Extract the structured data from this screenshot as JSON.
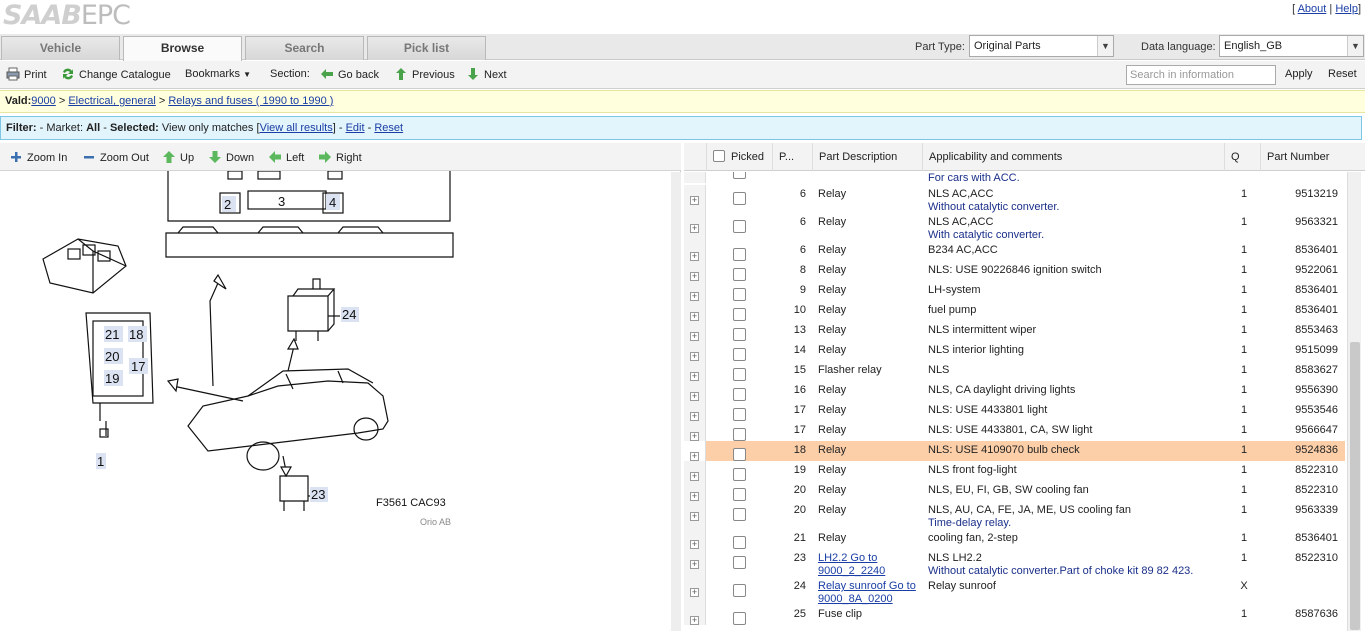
{
  "app": {
    "logo_brand": "SAAB",
    "logo_product": "EPC"
  },
  "toplinks": {
    "about": "About",
    "help": "Help"
  },
  "tabs": [
    {
      "label": "Vehicle"
    },
    {
      "label": "Browse"
    },
    {
      "label": "Search"
    },
    {
      "label": "Pick list"
    }
  ],
  "part_type": {
    "label": "Part Type:",
    "value": "Original Parts"
  },
  "data_language": {
    "label": "Data language:",
    "value": "English_GB"
  },
  "toolbar": {
    "print": "Print",
    "change_catalogue": "Change Catalogue",
    "bookmarks": "Bookmarks",
    "section": "Section:",
    "go_back": "Go back",
    "previous": "Previous",
    "next": "Next",
    "search_placeholder": "Search in information",
    "apply": "Apply",
    "reset": "Reset"
  },
  "breadcrumb": {
    "prefix": "Vald:",
    "model": "9000",
    "group": "Electrical, general",
    "section": "Relays and fuses ( 1990 to 1990 )"
  },
  "filter": {
    "label": "Filter:",
    "market_label": "Market:",
    "market": "All",
    "selected_label": "Selected:",
    "selected": "View only matches",
    "view_all": "View all results",
    "edit": "Edit",
    "reset": "Reset"
  },
  "zoombar": {
    "zoom_in": "Zoom In",
    "zoom_out": "Zoom Out",
    "up": "Up",
    "down": "Down",
    "left": "Left",
    "right": "Right"
  },
  "illustration": {
    "code": "F3561 CAC93",
    "copyright": "Orio AB",
    "callouts": [
      "2",
      "3",
      "4",
      "21",
      "18",
      "20",
      "17",
      "19",
      "24",
      "1",
      "23"
    ]
  },
  "table": {
    "headers": {
      "picked": "Picked",
      "pos": "P...",
      "desc": "Part Description",
      "app": "Applicability and comments",
      "qty": "Q",
      "pn": "Part Number"
    },
    "partial_row_note": "For cars with ACC.",
    "rows": [
      {
        "pos": "6",
        "desc": "Relay",
        "app": "NLS AC,ACC",
        "note": "Without catalytic converter.",
        "qty": "1",
        "pn": "9513219"
      },
      {
        "pos": "6",
        "desc": "Relay",
        "app": "NLS AC,ACC",
        "note": "With catalytic converter.",
        "qty": "1",
        "pn": "9563321"
      },
      {
        "pos": "6",
        "desc": "Relay",
        "app": "B234 AC,ACC",
        "note": "",
        "qty": "1",
        "pn": "8536401"
      },
      {
        "pos": "8",
        "desc": "Relay",
        "app": "NLS: USE 90226846 ignition switch",
        "note": "",
        "qty": "1",
        "pn": "9522061"
      },
      {
        "pos": "9",
        "desc": "Relay",
        "app": "LH-system",
        "note": "",
        "qty": "1",
        "pn": "8536401"
      },
      {
        "pos": "10",
        "desc": "Relay",
        "app": "fuel pump",
        "note": "",
        "qty": "1",
        "pn": "8536401"
      },
      {
        "pos": "13",
        "desc": "Relay",
        "app": "NLS intermittent wiper",
        "note": "",
        "qty": "1",
        "pn": "8553463"
      },
      {
        "pos": "14",
        "desc": "Relay",
        "app": "NLS interior lighting",
        "note": "",
        "qty": "1",
        "pn": "9515099"
      },
      {
        "pos": "15",
        "desc": "Flasher relay",
        "app": "NLS",
        "note": "",
        "qty": "1",
        "pn": "8583627"
      },
      {
        "pos": "16",
        "desc": "Relay",
        "app": "NLS, CA daylight driving lights",
        "note": "",
        "qty": "1",
        "pn": "9556390"
      },
      {
        "pos": "17",
        "desc": "Relay",
        "app": "NLS: USE 4433801 light",
        "note": "",
        "qty": "1",
        "pn": "9553546"
      },
      {
        "pos": "17",
        "desc": "Relay",
        "app": "NLS: USE 4433801, CA, SW light",
        "note": "",
        "qty": "1",
        "pn": "9566647"
      },
      {
        "pos": "18",
        "desc": "Relay",
        "app": "NLS: USE 4109070 bulb check",
        "note": "",
        "qty": "1",
        "pn": "9524836",
        "highlight": true
      },
      {
        "pos": "19",
        "desc": "Relay",
        "app": "NLS front fog-light",
        "note": "",
        "qty": "1",
        "pn": "8522310"
      },
      {
        "pos": "20",
        "desc": "Relay",
        "app": "NLS, EU, FI, GB, SW cooling fan",
        "note": "",
        "qty": "1",
        "pn": "8522310"
      },
      {
        "pos": "20",
        "desc": "Relay",
        "app": "NLS, AU, CA, FE, JA, ME, US cooling fan",
        "note": "Time-delay relay.",
        "qty": "1",
        "pn": "9563339"
      },
      {
        "pos": "21",
        "desc": "Relay",
        "app": "cooling fan, 2-step",
        "note": "",
        "qty": "1",
        "pn": "8536401"
      },
      {
        "pos": "23",
        "desc": "LH2.2 Go to 9000_2_2240",
        "desc_link": true,
        "app": "NLS LH2.2",
        "note": "Without catalytic converter.Part of choke kit 89 82 423.",
        "qty": "1",
        "pn": "8522310"
      },
      {
        "pos": "24",
        "desc": "Relay sunroof Go to 9000_8A_0200",
        "desc_link": true,
        "app": "Relay sunroof",
        "note": "",
        "qty": "X",
        "pn": ""
      },
      {
        "pos": "25",
        "desc": "Fuse clip",
        "app": "",
        "note": "",
        "qty": "1",
        "pn": "8587636"
      }
    ]
  }
}
